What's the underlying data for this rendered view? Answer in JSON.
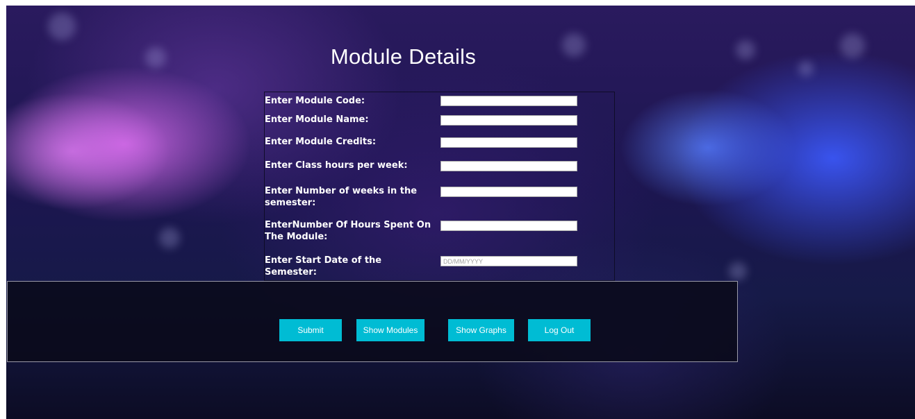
{
  "page": {
    "title": "Module Details"
  },
  "form": {
    "fields": [
      {
        "label": "Enter Module Code:",
        "value": "",
        "placeholder": ""
      },
      {
        "label": "Enter Module Name:",
        "value": "",
        "placeholder": ""
      },
      {
        "label": "Enter Module Credits:",
        "value": "",
        "placeholder": ""
      },
      {
        "label": "Enter Class hours per week:",
        "value": "",
        "placeholder": ""
      },
      {
        "label": "Enter Number of weeks in the semester:",
        "value": "",
        "placeholder": ""
      },
      {
        "label": "EnterNumber Of Hours Spent On The Module:",
        "value": "",
        "placeholder": ""
      },
      {
        "label": "Enter Start Date of the Semester:",
        "value": "",
        "placeholder": "DD/MM/YYYY"
      }
    ]
  },
  "buttons": {
    "submit": "Submit",
    "show_modules": "Show Modules",
    "show_graphs": "Show Graphs",
    "log_out": "Log Out"
  },
  "colors": {
    "button_bg": "#00bcd4",
    "button_text": "#ffffff",
    "title_text": "#ffffff"
  }
}
